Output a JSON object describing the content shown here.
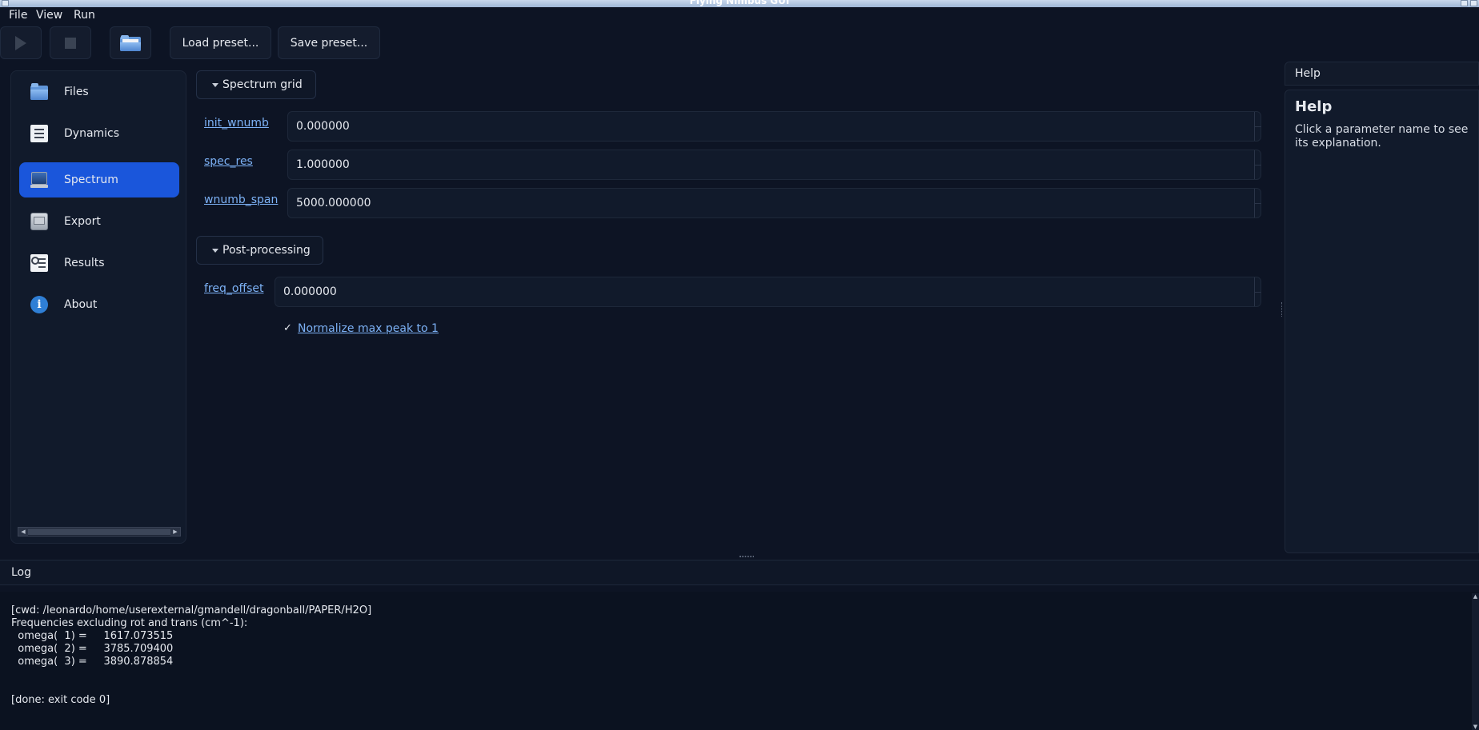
{
  "window": {
    "title": "Flying Nimbus GUI"
  },
  "menu": {
    "file": "File",
    "view": "View",
    "run": "Run"
  },
  "toolbar": {
    "run_icon": "play-icon",
    "stop_icon": "stop-icon",
    "open_icon": "folder-icon",
    "load_preset": "Load preset...",
    "save_preset": "Save preset..."
  },
  "sidebar": {
    "active": "Spectrum",
    "items": [
      {
        "label": "Files",
        "icon": "folder-icon"
      },
      {
        "label": "Dynamics",
        "icon": "document-icon"
      },
      {
        "label": "Spectrum",
        "icon": "monitor-icon"
      },
      {
        "label": "Export",
        "icon": "drive-icon"
      },
      {
        "label": "Results",
        "icon": "search-document-icon"
      },
      {
        "label": "About",
        "icon": "info-icon"
      }
    ]
  },
  "main": {
    "spectrum_grid": {
      "title": "Spectrum grid",
      "params": [
        {
          "name": "init_wnumb",
          "value": "0.000000"
        },
        {
          "name": "spec_res",
          "value": "1.000000"
        },
        {
          "name": "wnumb_span",
          "value": "5000.000000"
        }
      ]
    },
    "post_processing": {
      "title": "Post-processing",
      "params": [
        {
          "name": "freq_offset",
          "value": "0.000000"
        }
      ],
      "normalize": {
        "label": "Normalize max peak to 1",
        "checked": true,
        "mark": "✓"
      }
    }
  },
  "help": {
    "header": "Help",
    "title": "Help",
    "text": "Click a parameter name to see its explanation."
  },
  "log": {
    "header": "Log",
    "lines": [
      "[cwd: /leonardo/home/userexternal/gmandell/dragonball/PAPER/H2O]",
      "Frequencies excluding rot and trans (cm^-1):",
      "  omega(  1) =     1617.073515",
      "  omega(  2) =     3785.709400",
      "  omega(  3) =     3890.878854",
      "[done: exit code 0]"
    ]
  },
  "colors": {
    "background": "#0d1424",
    "accent": "#1a56db",
    "link": "#7cb1f5"
  }
}
